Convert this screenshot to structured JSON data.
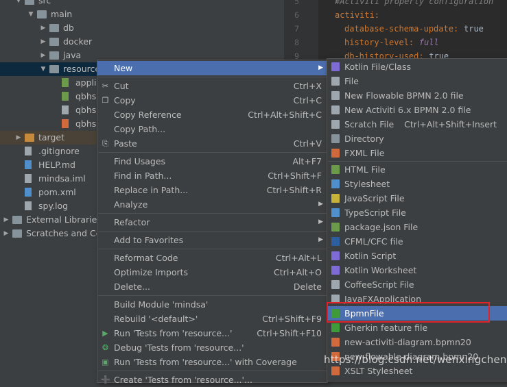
{
  "tree": {
    "rows": [
      {
        "label": "src",
        "indent": 1,
        "arrow": "down",
        "icon": "folder"
      },
      {
        "label": "main",
        "indent": 2,
        "arrow": "down",
        "icon": "folder"
      },
      {
        "label": "db",
        "indent": 3,
        "arrow": "right",
        "icon": "folder"
      },
      {
        "label": "docker",
        "indent": 3,
        "arrow": "right",
        "icon": "folder"
      },
      {
        "label": "java",
        "indent": 3,
        "arrow": "right",
        "icon": "folder"
      },
      {
        "label": "resource",
        "indent": 3,
        "arrow": "down",
        "icon": "folder",
        "selected": true
      },
      {
        "label": "appli",
        "indent": 4,
        "arrow": "",
        "icon": "green"
      },
      {
        "label": "qbhs.",
        "indent": 4,
        "arrow": "",
        "icon": "bpmn"
      },
      {
        "label": "qbhs",
        "indent": 4,
        "arrow": "",
        "icon": "file"
      },
      {
        "label": "qbhs",
        "indent": 4,
        "arrow": "",
        "icon": "xml"
      },
      {
        "label": "target",
        "indent": 1,
        "arrow": "right",
        "icon": "orange",
        "dim": true
      },
      {
        "label": ".gitignore",
        "indent": 1,
        "arrow": "",
        "icon": "file"
      },
      {
        "label": "HELP.md",
        "indent": 1,
        "arrow": "",
        "icon": "blue"
      },
      {
        "label": "mindsa.iml",
        "indent": 1,
        "arrow": "",
        "icon": "file"
      },
      {
        "label": "pom.xml",
        "indent": 1,
        "arrow": "",
        "icon": "blue"
      },
      {
        "label": "spy.log",
        "indent": 1,
        "arrow": "",
        "icon": "file"
      },
      {
        "label": "External Libraries",
        "indent": 0,
        "arrow": "right",
        "icon": "lib"
      },
      {
        "label": "Scratches and Co",
        "indent": 0,
        "arrow": "right",
        "icon": "scratch"
      }
    ]
  },
  "editor": {
    "lines": [
      {
        "num": "5",
        "text": "#Activiti property configuration",
        "cls": "cm"
      },
      {
        "num": "6",
        "text": "activiti:",
        "cls": "k"
      },
      {
        "num": "7",
        "key": "database-schema-update:",
        "val": "true"
      },
      {
        "num": "8",
        "key": "history-level:",
        "val": "full",
        "valcls": "it"
      },
      {
        "num": "9",
        "key": "db-history-used:",
        "val": "true"
      }
    ]
  },
  "context_menu": {
    "items": [
      {
        "label": "New",
        "shortcut": "",
        "submenu": true,
        "highlighted": true,
        "icon": ""
      },
      {
        "sep": true
      },
      {
        "label": "Cut",
        "shortcut": "Ctrl+X",
        "icon": "cut"
      },
      {
        "label": "Copy",
        "shortcut": "Ctrl+C",
        "icon": "copy"
      },
      {
        "label": "Copy Reference",
        "shortcut": "Ctrl+Alt+Shift+C"
      },
      {
        "label": "Copy Path...",
        "shortcut": ""
      },
      {
        "label": "Paste",
        "shortcut": "Ctrl+V",
        "icon": "paste"
      },
      {
        "sep": true
      },
      {
        "label": "Find Usages",
        "shortcut": "Alt+F7"
      },
      {
        "label": "Find in Path...",
        "shortcut": "Ctrl+Shift+F"
      },
      {
        "label": "Replace in Path...",
        "shortcut": "Ctrl+Shift+R"
      },
      {
        "label": "Analyze",
        "shortcut": "",
        "submenu": true
      },
      {
        "sep": true
      },
      {
        "label": "Refactor",
        "shortcut": "",
        "submenu": true
      },
      {
        "sep": true
      },
      {
        "label": "Add to Favorites",
        "shortcut": "",
        "submenu": true
      },
      {
        "sep": true
      },
      {
        "label": "Reformat Code",
        "shortcut": "Ctrl+Alt+L"
      },
      {
        "label": "Optimize Imports",
        "shortcut": "Ctrl+Alt+O"
      },
      {
        "label": "Delete...",
        "shortcut": "Delete"
      },
      {
        "sep": true
      },
      {
        "label": "Build Module 'mindsa'",
        "shortcut": ""
      },
      {
        "label": "Rebuild '<default>'",
        "shortcut": "Ctrl+Shift+F9"
      },
      {
        "label": "Run 'Tests from 'resource...'",
        "shortcut": "Ctrl+Shift+F10",
        "icon": "run"
      },
      {
        "label": "Debug 'Tests from 'resource...'",
        "shortcut": "",
        "icon": "debug"
      },
      {
        "label": "Run 'Tests from 'resource...' with Coverage",
        "shortcut": "",
        "icon": "coverage"
      },
      {
        "sep": true
      },
      {
        "label": "Create 'Tests from 'resource...'...",
        "shortcut": "",
        "icon": "create"
      }
    ]
  },
  "new_submenu": {
    "items": [
      {
        "label": "Kotlin File/Class",
        "color": "#7f6bd6"
      },
      {
        "label": "File",
        "color": "#9ea7ad"
      },
      {
        "label": "New Flowable BPMN 2.0 file",
        "color": "#9ea7ad"
      },
      {
        "label": "New Activiti 6.x BPMN 2.0 file",
        "color": "#9ea7ad"
      },
      {
        "label": "Scratch File",
        "shortcut": "Ctrl+Alt+Shift+Insert",
        "color": "#9ea7ad"
      },
      {
        "label": "Directory",
        "color": "#87939a"
      },
      {
        "label": "FXML File",
        "color": "#d06a3c"
      },
      {
        "sep": true
      },
      {
        "label": "HTML File",
        "color": "#6a9a4a"
      },
      {
        "label": "Stylesheet",
        "color": "#4f8fcc"
      },
      {
        "label": "JavaScript File",
        "color": "#c8b23a"
      },
      {
        "label": "TypeScript File",
        "color": "#4f8fcc"
      },
      {
        "label": "package.json File",
        "color": "#6a9a4a"
      },
      {
        "label": "CFML/CFC file",
        "color": "#2b5f9e"
      },
      {
        "label": "Kotlin Script",
        "color": "#7f6bd6"
      },
      {
        "label": "Kotlin Worksheet",
        "color": "#7f6bd6"
      },
      {
        "label": "CoffeeScript File",
        "color": "#9ea7ad"
      },
      {
        "label": "JavaFXApplication",
        "color": "#9ea7ad"
      },
      {
        "label": "BpmnFile",
        "color": "#3f9a3a",
        "highlighted": true
      },
      {
        "label": "Gherkin feature file",
        "color": "#3f9a3a"
      },
      {
        "label": "new-activiti-diagram.bpmn20",
        "color": "#d06a3c"
      },
      {
        "label": "new-flowable-diagram.bpmn20",
        "color": "#d06a3c"
      },
      {
        "label": "XSLT Stylesheet",
        "color": "#d06a3c"
      }
    ]
  },
  "watermark": "https://blog.csdn.net/wenxingchen"
}
